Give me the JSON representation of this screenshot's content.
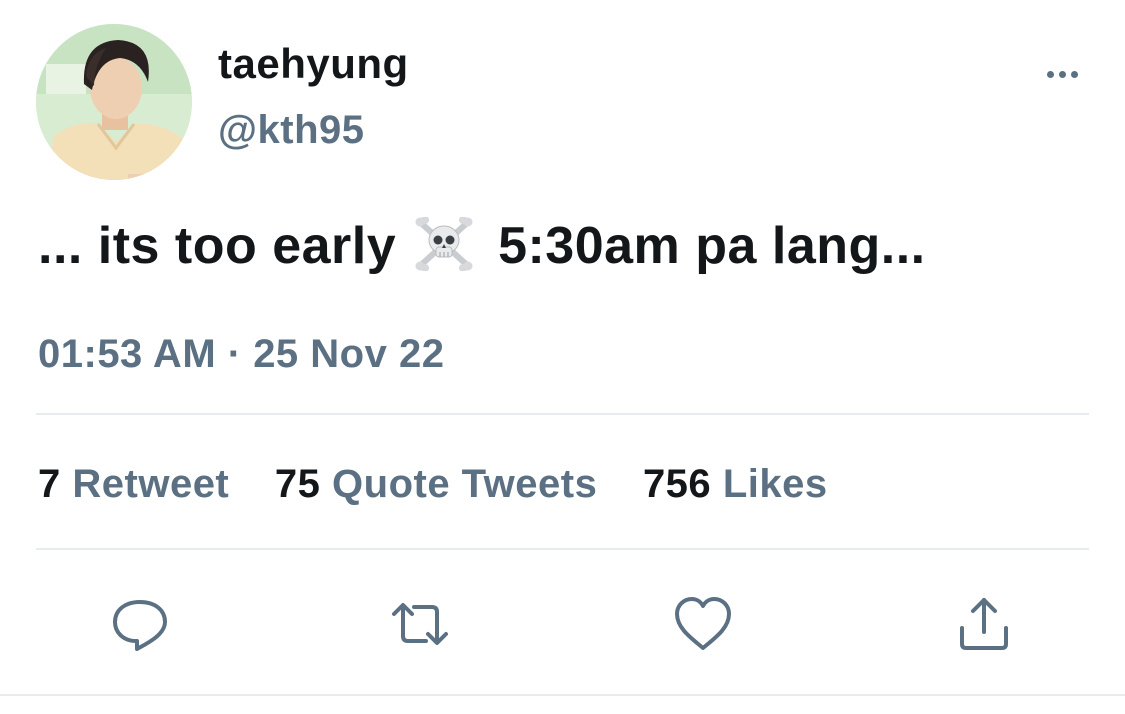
{
  "tweet": {
    "author": {
      "display_name": "taehyung",
      "handle": "@kth95"
    },
    "text": {
      "before_emoji": "... its too early",
      "emoji": "skull-and-crossbones-emoji",
      "after_emoji": "5:30am pa lang..."
    },
    "timestamp": "01:53 AM · 25 Nov 22",
    "stats": [
      {
        "count": "7",
        "label": "Retweet"
      },
      {
        "count": "75",
        "label": "Quote Tweets"
      },
      {
        "count": "756",
        "label": "Likes"
      }
    ],
    "actions": {
      "reply_icon": "reply-icon",
      "retweet_icon": "retweet-icon",
      "like_icon": "heart-icon",
      "share_icon": "share-icon"
    },
    "colors": {
      "text_primary": "#14171a",
      "text_secondary": "#5b7083",
      "divider": "#e6ecf0"
    }
  }
}
